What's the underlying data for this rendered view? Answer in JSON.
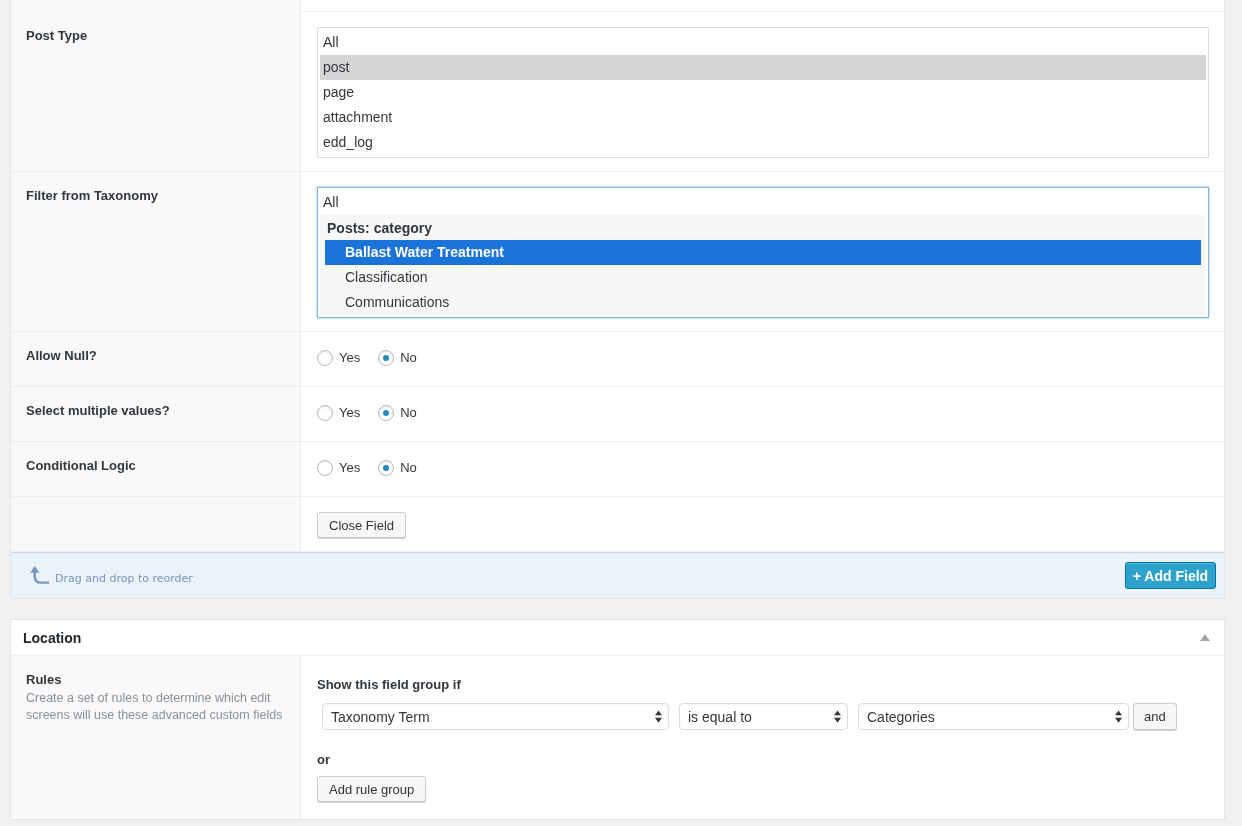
{
  "field_settings": [
    {
      "kind": "listbox",
      "label": "Post Type",
      "focused": false,
      "options": [
        {
          "kind": "option",
          "label": "All",
          "selected": false
        },
        {
          "kind": "option",
          "label": "post",
          "selected": true
        },
        {
          "kind": "option",
          "label": "page",
          "selected": false
        },
        {
          "kind": "option",
          "label": "attachment",
          "selected": false
        },
        {
          "kind": "option",
          "label": "edd_log",
          "selected": false
        }
      ]
    },
    {
      "kind": "listbox",
      "label": "Filter from Taxonomy",
      "focused": true,
      "options": [
        {
          "kind": "option",
          "label": "All",
          "selected": false
        },
        {
          "kind": "group",
          "label": "Posts: category",
          "options": [
            {
              "label": "Ballast Water Treatment",
              "selected": true
            },
            {
              "label": "Classification",
              "selected": false
            },
            {
              "label": "Communications",
              "selected": false
            }
          ]
        }
      ]
    },
    {
      "kind": "radio",
      "label": "Allow Null?",
      "choices": [
        {
          "label": "Yes",
          "selected": false
        },
        {
          "label": "No",
          "selected": true
        }
      ]
    },
    {
      "kind": "radio",
      "label": "Select multiple values?",
      "choices": [
        {
          "label": "Yes",
          "selected": false
        },
        {
          "label": "No",
          "selected": true
        }
      ]
    },
    {
      "kind": "radio",
      "label": "Conditional Logic",
      "choices": [
        {
          "label": "Yes",
          "selected": false
        },
        {
          "label": "No",
          "selected": true
        }
      ]
    },
    {
      "kind": "button",
      "button": "Close Field"
    }
  ],
  "footer": {
    "hint": "Drag and drop to reorder",
    "add_button": "+ Add Field"
  },
  "location": {
    "title": "Location",
    "expanded": true,
    "rules": {
      "label": "Rules",
      "description": "Create a set of rules to determine which edit screens will use these advanced custom fields",
      "heading": "Show this field group if",
      "rule": {
        "selects": [
          "Taxonomy Term",
          "is equal to",
          "Categories"
        ],
        "and_button": "and"
      },
      "or_label": "or",
      "add_group_button": "Add rule group"
    }
  }
}
